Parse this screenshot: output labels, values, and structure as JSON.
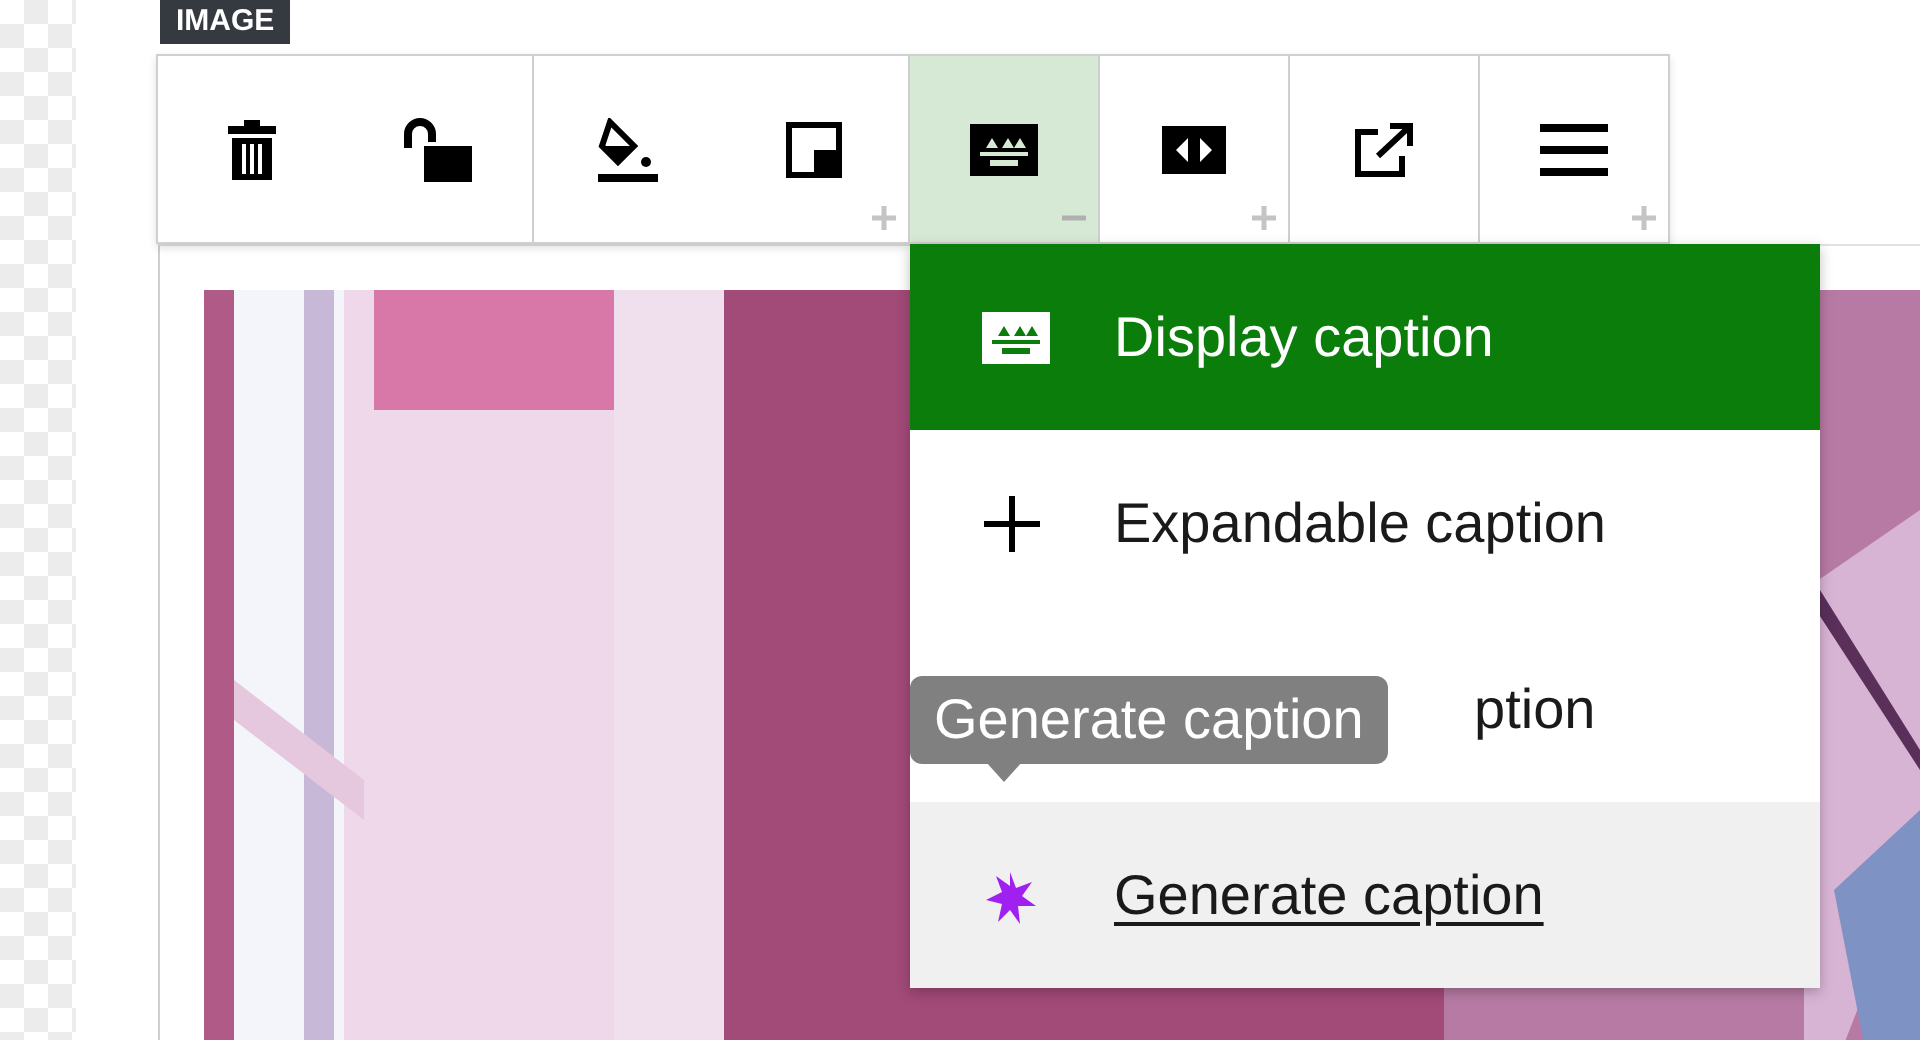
{
  "badge": "IMAGE",
  "toolbar": {
    "groups": [
      {
        "buttons": [
          {
            "kind": "plain",
            "selected": false
          },
          {
            "kind": "plain",
            "selected": false
          }
        ]
      },
      {
        "buttons": [
          {
            "kind": "plain",
            "selected": false
          },
          {
            "kind": "plus",
            "selected": false
          }
        ]
      },
      {
        "buttons": [
          {
            "kind": "minus",
            "selected": true
          }
        ]
      },
      {
        "buttons": [
          {
            "kind": "plus",
            "selected": false
          }
        ]
      },
      {
        "buttons": [
          {
            "kind": "plain",
            "selected": false
          }
        ]
      },
      {
        "buttons": [
          {
            "kind": "plus",
            "selected": false
          }
        ]
      }
    ]
  },
  "menu": {
    "items": [
      {
        "kind": "full",
        "label": "Display caption",
        "selected": true,
        "highlighted": false
      },
      {
        "kind": "full",
        "label": "Expandable caption",
        "selected": false,
        "highlighted": false
      },
      {
        "kind": "covered",
        "label": "ption",
        "selected": false,
        "highlighted": false
      },
      {
        "kind": "full",
        "label": "Generate caption",
        "selected": false,
        "highlighted": true
      }
    ]
  },
  "tooltip": {
    "text": "Generate caption"
  }
}
